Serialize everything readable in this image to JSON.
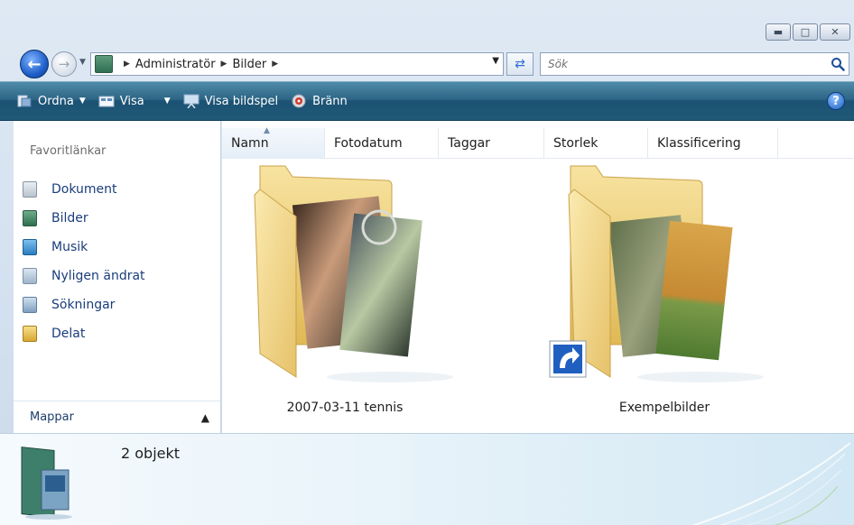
{
  "window": {
    "caption_buttons": [
      "minimize",
      "maximize",
      "close"
    ]
  },
  "address": {
    "breadcrumb": [
      "Administratör",
      "Bilder"
    ],
    "search_placeholder": "Sök"
  },
  "commandbar": {
    "items": [
      {
        "label": "Ordna",
        "icon": "organize-icon",
        "has_dropdown": true
      },
      {
        "label": "Visa",
        "icon": "views-icon",
        "has_dropdown": true
      },
      {
        "label": "Visa bildspel",
        "icon": "slideshow-icon",
        "has_dropdown": false
      },
      {
        "label": "Bränn",
        "icon": "burn-icon",
        "has_dropdown": false
      }
    ],
    "help_label": "?"
  },
  "navpane": {
    "favorites_heading": "Favoritlänkar",
    "favorites": [
      {
        "label": "Dokument",
        "icon": "documents-icon"
      },
      {
        "label": "Bilder",
        "icon": "pictures-icon"
      },
      {
        "label": "Musik",
        "icon": "music-icon"
      },
      {
        "label": "Nyligen ändrat",
        "icon": "recently-changed-icon"
      },
      {
        "label": "Sökningar",
        "icon": "searches-icon"
      },
      {
        "label": "Delat",
        "icon": "shared-icon"
      }
    ],
    "folders_label": "Mappar"
  },
  "columns": [
    "Namn",
    "Fotodatum",
    "Taggar",
    "Storlek",
    "Klassificering"
  ],
  "sorted_column": "Namn",
  "items": [
    {
      "name": "2007-03-11 tennis",
      "icon": "photo-folder-icon",
      "shortcut": false
    },
    {
      "name": "Exempelbilder",
      "icon": "photo-folder-icon",
      "shortcut": true
    }
  ],
  "details": {
    "count_text": "2 objekt"
  },
  "colors": {
    "commandbar": "#2d6686",
    "link": "#1a3d7c",
    "folder": "#f2d77a"
  }
}
